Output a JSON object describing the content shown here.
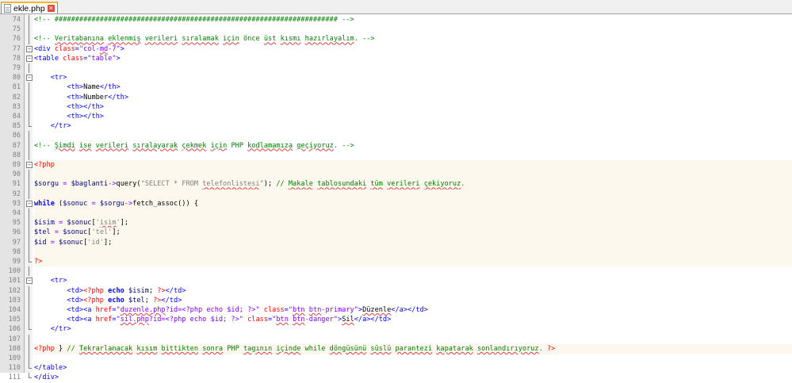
{
  "tab": {
    "filename": "ekle.php",
    "icon": "php-file-icon",
    "close_icon": "close-tab-icon"
  },
  "lines": [
    {
      "n": "74",
      "fold": "line",
      "php": false,
      "tokens": [
        [
          "cm",
          "<!-- ##################################################################### -->"
        ]
      ]
    },
    {
      "n": "75",
      "fold": "line",
      "php": false,
      "tokens": []
    },
    {
      "n": "76",
      "fold": "line",
      "php": false,
      "tokens": [
        [
          "cm",
          "<!-- "
        ],
        [
          "cm-sp",
          "Veritabanına"
        ],
        [
          "cm",
          " "
        ],
        [
          "cm-sp",
          "eklenmiş"
        ],
        [
          "cm",
          " "
        ],
        [
          "cm-sp",
          "verileri"
        ],
        [
          "cm",
          " "
        ],
        [
          "cm-sp",
          "sıralamak"
        ],
        [
          "cm",
          " "
        ],
        [
          "cm-sp",
          "için"
        ],
        [
          "cm",
          " önce "
        ],
        [
          "cm-sp",
          "üst"
        ],
        [
          "cm",
          " "
        ],
        [
          "cm-sp",
          "kısmı"
        ],
        [
          "cm",
          " "
        ],
        [
          "cm-sp",
          "hazırlayalım"
        ],
        [
          "cm",
          ". -->"
        ]
      ]
    },
    {
      "n": "77",
      "fold": "box",
      "php": false,
      "tokens": [
        [
          "tag",
          "<div "
        ],
        [
          "at",
          "class"
        ],
        [
          "tag",
          "="
        ],
        [
          "str",
          "\"col-"
        ],
        [
          "str-sp",
          "md"
        ],
        [
          "str",
          "-7\""
        ],
        [
          "tag",
          ">"
        ]
      ]
    },
    {
      "n": "78",
      "fold": "box",
      "php": false,
      "tokens": [
        [
          "tag",
          "<table "
        ],
        [
          "at",
          "class"
        ],
        [
          "tag",
          "="
        ],
        [
          "str",
          "\"table\""
        ],
        [
          "tag",
          ">"
        ]
      ]
    },
    {
      "n": "79",
      "fold": "line",
      "php": false,
      "tokens": []
    },
    {
      "n": "80",
      "fold": "box",
      "php": false,
      "tokens": [
        [
          "plain",
          "    "
        ],
        [
          "tag",
          "<tr>"
        ]
      ]
    },
    {
      "n": "81",
      "fold": "line",
      "php": false,
      "tokens": [
        [
          "plain",
          "        "
        ],
        [
          "tag",
          "<th>"
        ],
        [
          "plain",
          "Name"
        ],
        [
          "tag",
          "</th>"
        ]
      ]
    },
    {
      "n": "82",
      "fold": "line",
      "php": false,
      "tokens": [
        [
          "plain",
          "        "
        ],
        [
          "tag",
          "<th>"
        ],
        [
          "plain",
          "Number"
        ],
        [
          "tag",
          "</th>"
        ]
      ]
    },
    {
      "n": "83",
      "fold": "line",
      "php": false,
      "tokens": [
        [
          "plain",
          "        "
        ],
        [
          "tag",
          "<th></th>"
        ]
      ]
    },
    {
      "n": "84",
      "fold": "line",
      "php": false,
      "tokens": [
        [
          "plain",
          "        "
        ],
        [
          "tag",
          "<th></th>"
        ]
      ]
    },
    {
      "n": "85",
      "fold": "end",
      "php": false,
      "tokens": [
        [
          "plain",
          "    "
        ],
        [
          "tag",
          "</tr>"
        ]
      ]
    },
    {
      "n": "86",
      "fold": "line",
      "php": false,
      "tokens": []
    },
    {
      "n": "87",
      "fold": "line",
      "php": false,
      "tokens": [
        [
          "cm",
          "<!-- "
        ],
        [
          "cm-sp",
          "Şimdi"
        ],
        [
          "cm",
          " "
        ],
        [
          "cm-sp",
          "ise"
        ],
        [
          "cm",
          " "
        ],
        [
          "cm-sp",
          "verileri"
        ],
        [
          "cm",
          " "
        ],
        [
          "cm-sp",
          "sıralayarak"
        ],
        [
          "cm",
          " "
        ],
        [
          "cm-sp",
          "çekmek"
        ],
        [
          "cm",
          " "
        ],
        [
          "cm-sp",
          "için"
        ],
        [
          "cm",
          " PHP "
        ],
        [
          "cm-sp",
          "kodlamamıza"
        ],
        [
          "cm",
          " "
        ],
        [
          "cm-sp",
          "geçiyoruz"
        ],
        [
          "cm",
          ". -->"
        ]
      ]
    },
    {
      "n": "88",
      "fold": "line",
      "php": false,
      "tokens": []
    },
    {
      "n": "89",
      "fold": "box",
      "php": true,
      "tokens": [
        [
          "php",
          "<?php"
        ]
      ]
    },
    {
      "n": "90",
      "fold": "line",
      "php": true,
      "tokens": []
    },
    {
      "n": "91",
      "fold": "line",
      "php": true,
      "tokens": [
        [
          "var",
          "$sorgu"
        ],
        [
          "op",
          " = "
        ],
        [
          "var",
          "$baglanti"
        ],
        [
          "op",
          "->"
        ],
        [
          "plain",
          "query("
        ],
        [
          "pstr",
          "\"SELECT * FROM "
        ],
        [
          "pstr-sp",
          "telefonlistesi"
        ],
        [
          "pstr",
          "\""
        ],
        [
          "plain",
          "); "
        ],
        [
          "cm",
          "// "
        ],
        [
          "cm-sp",
          "Makale"
        ],
        [
          "cm",
          " "
        ],
        [
          "cm-sp",
          "tablosundaki"
        ],
        [
          "cm",
          " "
        ],
        [
          "cm-sp",
          "tüm"
        ],
        [
          "cm",
          " "
        ],
        [
          "cm-sp",
          "verileri"
        ],
        [
          "cm",
          " "
        ],
        [
          "cm-sp",
          "çekiyoruz"
        ],
        [
          "cm",
          "."
        ]
      ]
    },
    {
      "n": "92",
      "fold": "line",
      "php": true,
      "tokens": []
    },
    {
      "n": "93",
      "fold": "box",
      "php": true,
      "tokens": [
        [
          "kw",
          "while"
        ],
        [
          "plain",
          " ("
        ],
        [
          "var",
          "$sonuc"
        ],
        [
          "op",
          " = "
        ],
        [
          "var",
          "$sorgu"
        ],
        [
          "op",
          "->"
        ],
        [
          "plain",
          "fetch_assoc()) {"
        ]
      ]
    },
    {
      "n": "94",
      "fold": "line",
      "php": true,
      "tokens": []
    },
    {
      "n": "95",
      "fold": "line",
      "php": true,
      "tokens": [
        [
          "var",
          "$isim"
        ],
        [
          "op",
          " = "
        ],
        [
          "var",
          "$sonuc"
        ],
        [
          "plain",
          "["
        ],
        [
          "pstr",
          "'"
        ],
        [
          "pstr-sp",
          "isim"
        ],
        [
          "pstr",
          "'"
        ],
        [
          "plain",
          "];"
        ]
      ]
    },
    {
      "n": "96",
      "fold": "line",
      "php": true,
      "tokens": [
        [
          "var",
          "$tel"
        ],
        [
          "op",
          " = "
        ],
        [
          "var",
          "$sonuc"
        ],
        [
          "plain",
          "["
        ],
        [
          "pstr",
          "'tel'"
        ],
        [
          "plain",
          "];"
        ]
      ]
    },
    {
      "n": "97",
      "fold": "line",
      "php": true,
      "tokens": [
        [
          "var",
          "$id"
        ],
        [
          "op",
          " = "
        ],
        [
          "var",
          "$sonuc"
        ],
        [
          "plain",
          "["
        ],
        [
          "pstr",
          "'id'"
        ],
        [
          "plain",
          "];"
        ]
      ]
    },
    {
      "n": "98",
      "fold": "line",
      "php": true,
      "tokens": []
    },
    {
      "n": "99",
      "fold": "end",
      "php": true,
      "tokens": [
        [
          "php",
          "?>"
        ]
      ]
    },
    {
      "n": "100",
      "fold": "line",
      "php": false,
      "tokens": []
    },
    {
      "n": "101",
      "fold": "box",
      "php": false,
      "tokens": [
        [
          "plain",
          "    "
        ],
        [
          "tag",
          "<tr>"
        ]
      ]
    },
    {
      "n": "102",
      "fold": "line",
      "php": false,
      "tokens": [
        [
          "plain",
          "        "
        ],
        [
          "tag",
          "<td>"
        ],
        [
          "php",
          "<?php "
        ],
        [
          "kw",
          "echo"
        ],
        [
          "var",
          " $isim"
        ],
        [
          "plain",
          "; "
        ],
        [
          "php",
          "?>"
        ],
        [
          "tag",
          "</td>"
        ]
      ]
    },
    {
      "n": "103",
      "fold": "line",
      "php": false,
      "tokens": [
        [
          "plain",
          "        "
        ],
        [
          "tag",
          "<td>"
        ],
        [
          "php",
          "<?php "
        ],
        [
          "kw",
          "echo"
        ],
        [
          "var",
          " $tel"
        ],
        [
          "plain",
          "; "
        ],
        [
          "php",
          "?>"
        ],
        [
          "tag",
          "</td>"
        ]
      ]
    },
    {
      "n": "104",
      "fold": "line",
      "php": false,
      "tokens": [
        [
          "plain",
          "        "
        ],
        [
          "tag",
          "<td><a "
        ],
        [
          "at",
          "href"
        ],
        [
          "tag",
          "="
        ],
        [
          "str",
          "\""
        ],
        [
          "str-sp",
          "duzenle.php"
        ],
        [
          "str",
          "?id=<?php echo $id; ?>\""
        ],
        [
          "at",
          " class"
        ],
        [
          "tag",
          "="
        ],
        [
          "str",
          "\""
        ],
        [
          "str-sp",
          "btn"
        ],
        [
          "str",
          " "
        ],
        [
          "str-sp",
          "btn"
        ],
        [
          "str",
          "-primary\""
        ],
        [
          "tag",
          ">"
        ],
        [
          "plain-sp",
          "Düzenle"
        ],
        [
          "tag",
          "</a></td>"
        ]
      ]
    },
    {
      "n": "105",
      "fold": "line",
      "php": false,
      "tokens": [
        [
          "plain",
          "        "
        ],
        [
          "tag",
          "<td><a "
        ],
        [
          "at",
          "href"
        ],
        [
          "tag",
          "="
        ],
        [
          "str",
          "\""
        ],
        [
          "str-sp",
          "sil.php"
        ],
        [
          "str",
          "?id=<?php echo $id; ?>\""
        ],
        [
          "at",
          " class"
        ],
        [
          "tag",
          "="
        ],
        [
          "str",
          "\""
        ],
        [
          "str-sp",
          "btn"
        ],
        [
          "str",
          " "
        ],
        [
          "str-sp",
          "btn"
        ],
        [
          "str",
          "-danger\""
        ],
        [
          "tag",
          ">"
        ],
        [
          "plain-sp",
          "Sil"
        ],
        [
          "tag",
          "</a></td>"
        ]
      ]
    },
    {
      "n": "106",
      "fold": "end",
      "php": false,
      "tokens": [
        [
          "plain",
          "    "
        ],
        [
          "tag",
          "</tr>"
        ]
      ]
    },
    {
      "n": "107",
      "fold": "line",
      "php": false,
      "tokens": []
    },
    {
      "n": "108",
      "fold": "line",
      "php": true,
      "tokens": [
        [
          "php",
          "<?php "
        ],
        [
          "plain",
          "} "
        ],
        [
          "cm",
          "// "
        ],
        [
          "cm-sp",
          "Tekrarlanacak"
        ],
        [
          "cm",
          " "
        ],
        [
          "cm-sp",
          "kısım"
        ],
        [
          "cm",
          " "
        ],
        [
          "cm-sp",
          "bittikten"
        ],
        [
          "cm",
          " "
        ],
        [
          "cm-sp",
          "sonra"
        ],
        [
          "cm",
          " PHP "
        ],
        [
          "cm-sp",
          "tagının"
        ],
        [
          "cm",
          " "
        ],
        [
          "cm-sp",
          "içinde"
        ],
        [
          "cm",
          " while "
        ],
        [
          "cm-sp",
          "döngüsünü"
        ],
        [
          "cm",
          " "
        ],
        [
          "cm-sp",
          "süslü"
        ],
        [
          "cm",
          " "
        ],
        [
          "cm-sp",
          "parantezi"
        ],
        [
          "cm",
          " "
        ],
        [
          "cm-sp",
          "kapatarak"
        ],
        [
          "cm",
          " "
        ],
        [
          "cm-sp",
          "sonlandırıyoruz"
        ],
        [
          "cm",
          ". "
        ],
        [
          "php",
          "?>"
        ]
      ]
    },
    {
      "n": "109",
      "fold": "line",
      "php": false,
      "tokens": []
    },
    {
      "n": "110",
      "fold": "end",
      "php": false,
      "tokens": [
        [
          "tag",
          "</table>"
        ]
      ]
    },
    {
      "n": "111",
      "fold": "end",
      "php": false,
      "tokens": [
        [
          "tag",
          "</div>"
        ]
      ]
    }
  ]
}
